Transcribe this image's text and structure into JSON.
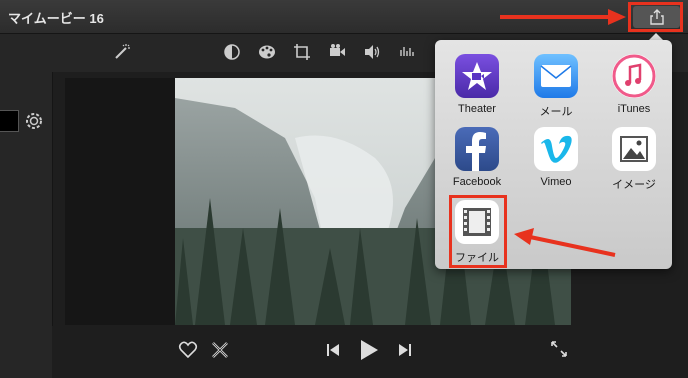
{
  "window": {
    "title": "マイムービー 16"
  },
  "toolbar": {
    "icons": [
      "magic-wand-icon",
      "color-balance-icon",
      "color-palette-icon",
      "crop-icon",
      "stabilization-icon",
      "volume-icon",
      "equalizer-icon"
    ]
  },
  "share": {
    "icon": "share-icon"
  },
  "share_menu": {
    "items": [
      {
        "label": "Theater",
        "icon": "theater-icon",
        "color": "#6b3fd1"
      },
      {
        "label": "メール",
        "icon": "mail-icon",
        "color": "#2e8ef0"
      },
      {
        "label": "iTunes",
        "icon": "itunes-icon",
        "color": "#f05a8a"
      },
      {
        "label": "Facebook",
        "icon": "facebook-icon",
        "color": "#3b5998"
      },
      {
        "label": "Vimeo",
        "icon": "vimeo-icon",
        "color": "#1ab7ea"
      },
      {
        "label": "イメージ",
        "icon": "image-icon",
        "color": "#ffffff"
      },
      {
        "label": "ファイル",
        "icon": "file-film-icon",
        "color": "#ffffff"
      }
    ]
  },
  "playback": {
    "icons": [
      "favorite-heart-icon",
      "reject-x-icon",
      "skip-back-icon",
      "play-icon",
      "skip-forward-icon",
      "fullscreen-icon"
    ]
  },
  "annotations": {
    "highlight_color": "#e8321e"
  }
}
